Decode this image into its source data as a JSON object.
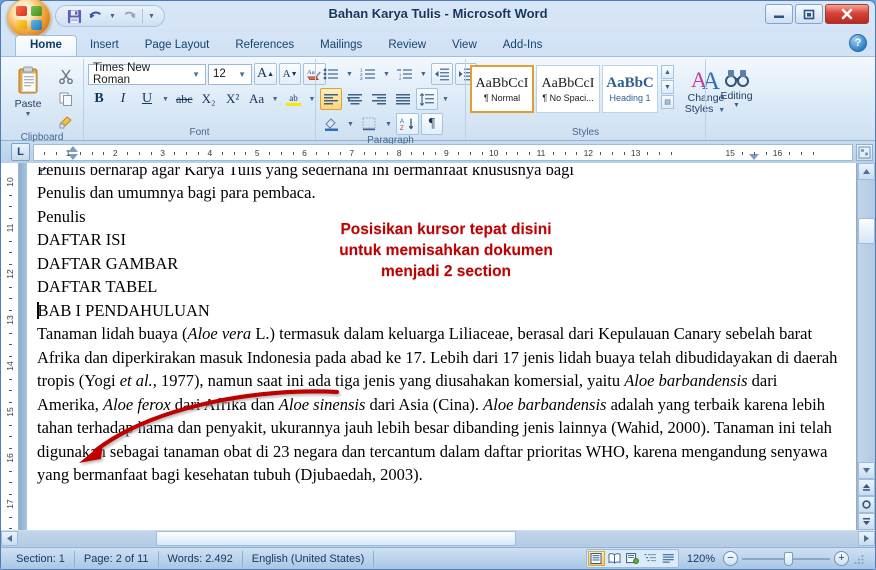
{
  "window": {
    "title": "Bahan Karya Tulis - Microsoft Word",
    "minimize": "minimize-button",
    "restore": "restore-button",
    "close": "close-button"
  },
  "quick_access": {
    "save": "save-icon",
    "undo": "undo-icon",
    "redo": "redo-icon",
    "customize": "customize-qat-icon"
  },
  "tabs": [
    {
      "label": "Home",
      "active": true
    },
    {
      "label": "Insert",
      "active": false
    },
    {
      "label": "Page Layout",
      "active": false
    },
    {
      "label": "References",
      "active": false
    },
    {
      "label": "Mailings",
      "active": false
    },
    {
      "label": "Review",
      "active": false
    },
    {
      "label": "View",
      "active": false
    },
    {
      "label": "Add-Ins",
      "active": false
    }
  ],
  "help": {
    "label": "?"
  },
  "ribbon": {
    "clipboard": {
      "label": "Clipboard",
      "paste_label": "Paste",
      "cut": "scissors-icon",
      "copy": "copy-icon",
      "format_painter": "format-painter-icon"
    },
    "font": {
      "label": "Font",
      "font_name": "Times New Roman",
      "font_size": "12",
      "grow_font": "A",
      "shrink_font": "A",
      "clear_formatting": "clear-formatting-icon",
      "bold": "B",
      "italic": "I",
      "underline": "U",
      "strikethrough": "abc",
      "subscript": "X₂",
      "superscript": "X²",
      "change_case": "Aa",
      "highlight": "ab",
      "font_color": "A"
    },
    "paragraph": {
      "label": "Paragraph",
      "bullets": "bullets-icon",
      "numbering": "numbering-icon",
      "multilevel": "multilevel-list-icon",
      "decrease_indent": "decrease-indent-icon",
      "increase_indent": "increase-indent-icon",
      "align_left": "align-left-icon",
      "align_center": "align-center-icon",
      "align_right": "align-right-icon",
      "justify": "justify-icon",
      "line_spacing": "line-spacing-icon",
      "shading": "shading-icon",
      "borders": "borders-icon",
      "sort": "sort-icon",
      "show_marks": "¶"
    },
    "styles": {
      "label": "Styles",
      "items": [
        {
          "preview": "AaBbCcI",
          "name": "¶ Normal",
          "selected": true
        },
        {
          "preview": "AaBbCcI",
          "name": "¶ No Spaci...",
          "selected": false
        },
        {
          "preview": "AaBbC",
          "name": "Heading 1",
          "selected": false
        }
      ],
      "change_styles_label": "Change\nStyles",
      "change_styles_line1": "Change",
      "change_styles_line2": "Styles"
    },
    "editing": {
      "label": "Editing",
      "icon": "binoculars-icon"
    }
  },
  "ruler": {
    "tab_selector": "L",
    "horizontal_marks": [
      "1",
      "2",
      "3",
      "4",
      "5",
      "6",
      "7",
      "8",
      "9",
      "10",
      "11",
      "12",
      "13",
      "15",
      "16"
    ],
    "vertical_marks": [
      "10",
      "11",
      "12",
      "13",
      "14",
      "15",
      "16",
      "17"
    ]
  },
  "document": {
    "clipped_top_line": "Penulis berharap agar Karya Tulis yang sederhana ini bermanfaat khususnya bagi",
    "line2": "Penulis dan umumnya bagi para pembaca.",
    "line3": "Penulis",
    "heading1": "DAFTAR ISI",
    "heading2": "DAFTAR GAMBAR",
    "heading3": "DAFTAR TABEL",
    "heading4": "BAB I PENDAHULUAN",
    "body_parts": {
      "p1a": "Tanaman lidah buaya (",
      "p1b": "Aloe vera",
      "p1c": " L.)  termasuk dalam keluarga Liliaceae,  berasal dari Kepulauan Canary sebelah barat Afrika dan diperkirakan masuk Indonesia pada abad ke 17. Lebih dari 17 jenis lidah buaya telah dibudidayakan di daerah tropis (Yogi ",
      "p1d": "et al.",
      "p1e": ", 1977), namun saat ini ada tiga jenis yang diusahakan komersial, yaitu ",
      "p1f": "Aloe barbandensis",
      "p1g": " dari Amerika, ",
      "p1h": "Aloe ferox",
      "p1i": " dari Afrika dan ",
      "p1j": "Aloe sinensis",
      "p1k": " dari Asia (Cina). ",
      "p1l": "Aloe barbandensis",
      "p1m": " adalah yang terbaik karena lebih tahan terhadap hama dan penyakit, ukurannya jauh lebih besar dibanding jenis lainnya (Wahid, 2000). Tanaman ini telah digunakan sebagai tanaman obat di 23 negara dan tercantum dalam daftar prioritas WHO, karena mengandung senyawa ",
      "p1n": "yang bermanfaat bagi kesehatan tubuh (Djubaedah, 2003)."
    }
  },
  "annotation": {
    "line1": "Posisikan kursor tepat disini",
    "line2": "untuk memisahkan dokumen",
    "line3": "menjadi 2 section",
    "color": "#c00000",
    "arrow": "curved-arrow"
  },
  "status_bar": {
    "section": "Section: 1",
    "page": "Page: 2 of 11",
    "words": "Words: 2.492",
    "language": "English (United States)",
    "views": [
      {
        "name": "print-layout-view",
        "active": true
      },
      {
        "name": "full-screen-reading-view",
        "active": false
      },
      {
        "name": "web-layout-view",
        "active": false
      },
      {
        "name": "outline-view",
        "active": false
      },
      {
        "name": "draft-view",
        "active": false
      }
    ],
    "zoom": "120%",
    "zoom_out": "−",
    "zoom_in": "+"
  }
}
